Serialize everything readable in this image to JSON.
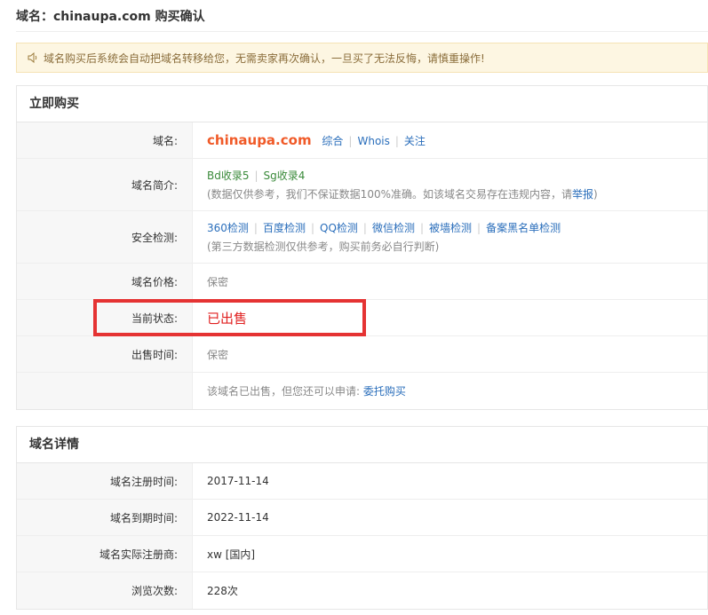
{
  "page": {
    "title": "域名：chinaupa.com 购买确认",
    "notice": "域名购买后系统会自动把域名转移给您，无需卖家再次确认，一旦买了无法反悔，请慎重操作!"
  },
  "buy_panel": {
    "heading": "立即购买",
    "domain_label": "域名:",
    "domain_value": "chinaupa.com",
    "domain_links": [
      "综合",
      "Whois",
      "关注"
    ],
    "intro_label": "域名简介:",
    "intro_bd": "Bd收录5",
    "intro_sg": "Sg收录4",
    "intro_note": "(数据仅供参考，我们不保证数据100%准确。如该域名交易存在违规内容，请",
    "intro_report": "举报",
    "intro_note_end": ")",
    "security_label": "安全检测:",
    "security_links": [
      "360检测",
      "百度检测",
      "QQ检测",
      "微信检测",
      "被墙检测",
      "备案黑名单检测"
    ],
    "security_note": "(第三方数据检测仅供参考，购买前务必自行判断)",
    "price_label": "域名价格:",
    "price_value": "保密",
    "status_label": "当前状态:",
    "status_value": "已出售",
    "sold_time_label": "出售时间:",
    "sold_time_value": "保密",
    "entrust_text": "该域名已出售，但您还可以申请:",
    "entrust_link": "委托购买"
  },
  "detail_panel": {
    "heading": "域名详情",
    "rows": [
      {
        "label": "域名注册时间:",
        "value": "2017-11-14"
      },
      {
        "label": "域名到期时间:",
        "value": "2022-11-14"
      },
      {
        "label": "域名实际注册商:",
        "value": "xw [国内]"
      },
      {
        "label": "浏览次数:",
        "value": "228次"
      }
    ]
  },
  "colors": {
    "domain": "#f05a28",
    "link": "#2a6ebb",
    "sold": "#e02020",
    "highlight": "#e53333",
    "notice_bg": "#fdf6e2"
  }
}
